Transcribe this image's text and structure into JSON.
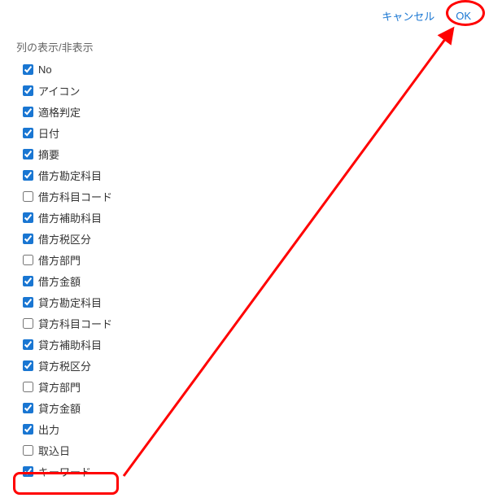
{
  "actions": {
    "cancel": "キャンセル",
    "ok": "OK"
  },
  "section_title": "列の表示/非表示",
  "columns": [
    {
      "label": "No",
      "checked": true
    },
    {
      "label": "アイコン",
      "checked": true
    },
    {
      "label": "適格判定",
      "checked": true
    },
    {
      "label": "日付",
      "checked": true
    },
    {
      "label": "摘要",
      "checked": true
    },
    {
      "label": "借方勘定科目",
      "checked": true
    },
    {
      "label": "借方科目コード",
      "checked": false
    },
    {
      "label": "借方補助科目",
      "checked": true
    },
    {
      "label": "借方税区分",
      "checked": true
    },
    {
      "label": "借方部門",
      "checked": false
    },
    {
      "label": "借方金額",
      "checked": true
    },
    {
      "label": "貸方勘定科目",
      "checked": true
    },
    {
      "label": "貸方科目コード",
      "checked": false
    },
    {
      "label": "貸方補助科目",
      "checked": true
    },
    {
      "label": "貸方税区分",
      "checked": true
    },
    {
      "label": "貸方部門",
      "checked": false
    },
    {
      "label": "貸方金額",
      "checked": true
    },
    {
      "label": "出力",
      "checked": true
    },
    {
      "label": "取込日",
      "checked": false
    },
    {
      "label": "キーワード",
      "checked": true
    }
  ]
}
